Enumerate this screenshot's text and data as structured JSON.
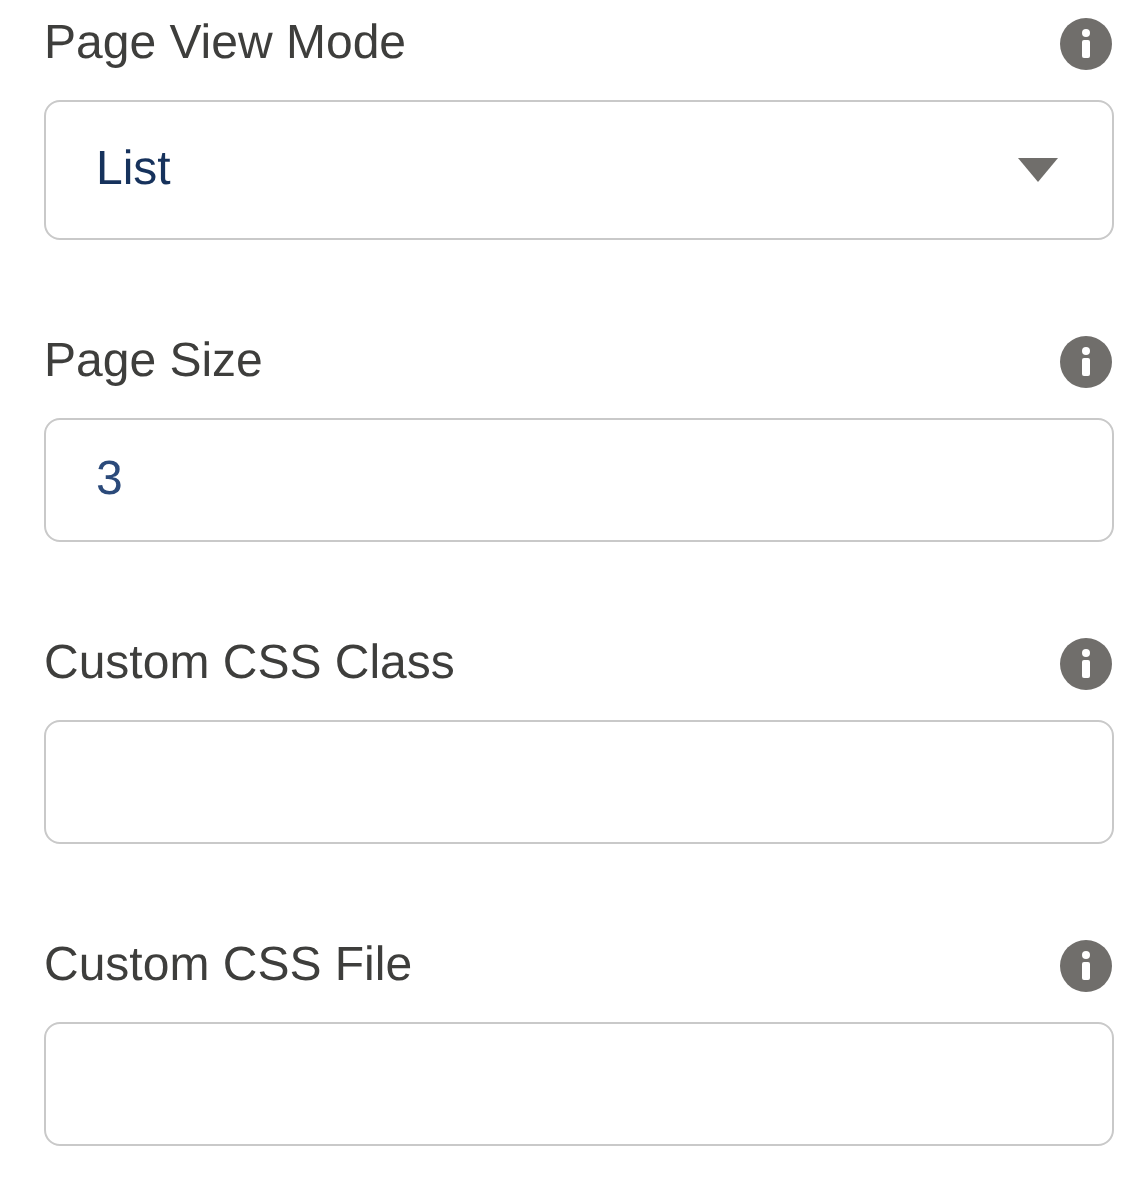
{
  "fields": [
    {
      "kind": "select",
      "label": "Page View Mode",
      "value": "List"
    },
    {
      "kind": "text",
      "label": "Page Size",
      "value": "3"
    },
    {
      "kind": "text",
      "label": "Custom CSS Class"
    },
    {
      "kind": "text",
      "label": "Custom CSS File"
    }
  ]
}
